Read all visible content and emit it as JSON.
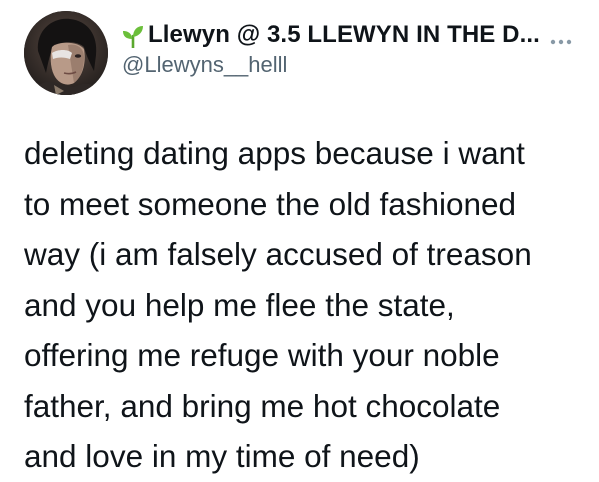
{
  "tweet": {
    "author": {
      "display_name": "Llewyn @ 3.5 LLEWYN IN THE D...",
      "handle": "@Llewyns__helll",
      "avatar_icon": "profile-photo",
      "name_emoji_icon": "seedling-icon",
      "more_icon": "more-options-icon"
    },
    "text_lines": [
      "deleting dating apps because i want",
      "to meet someone the old fashioned",
      "way (i am falsely accused of treason",
      "and you help me flee the state,",
      "offering me refuge with your noble",
      "father, and bring me hot chocolate",
      "and love in my time of need)"
    ]
  },
  "colors": {
    "text_primary": "#0f1419",
    "text_secondary": "#536471",
    "sprout_green": "#6bbf3a",
    "background": "#ffffff"
  }
}
